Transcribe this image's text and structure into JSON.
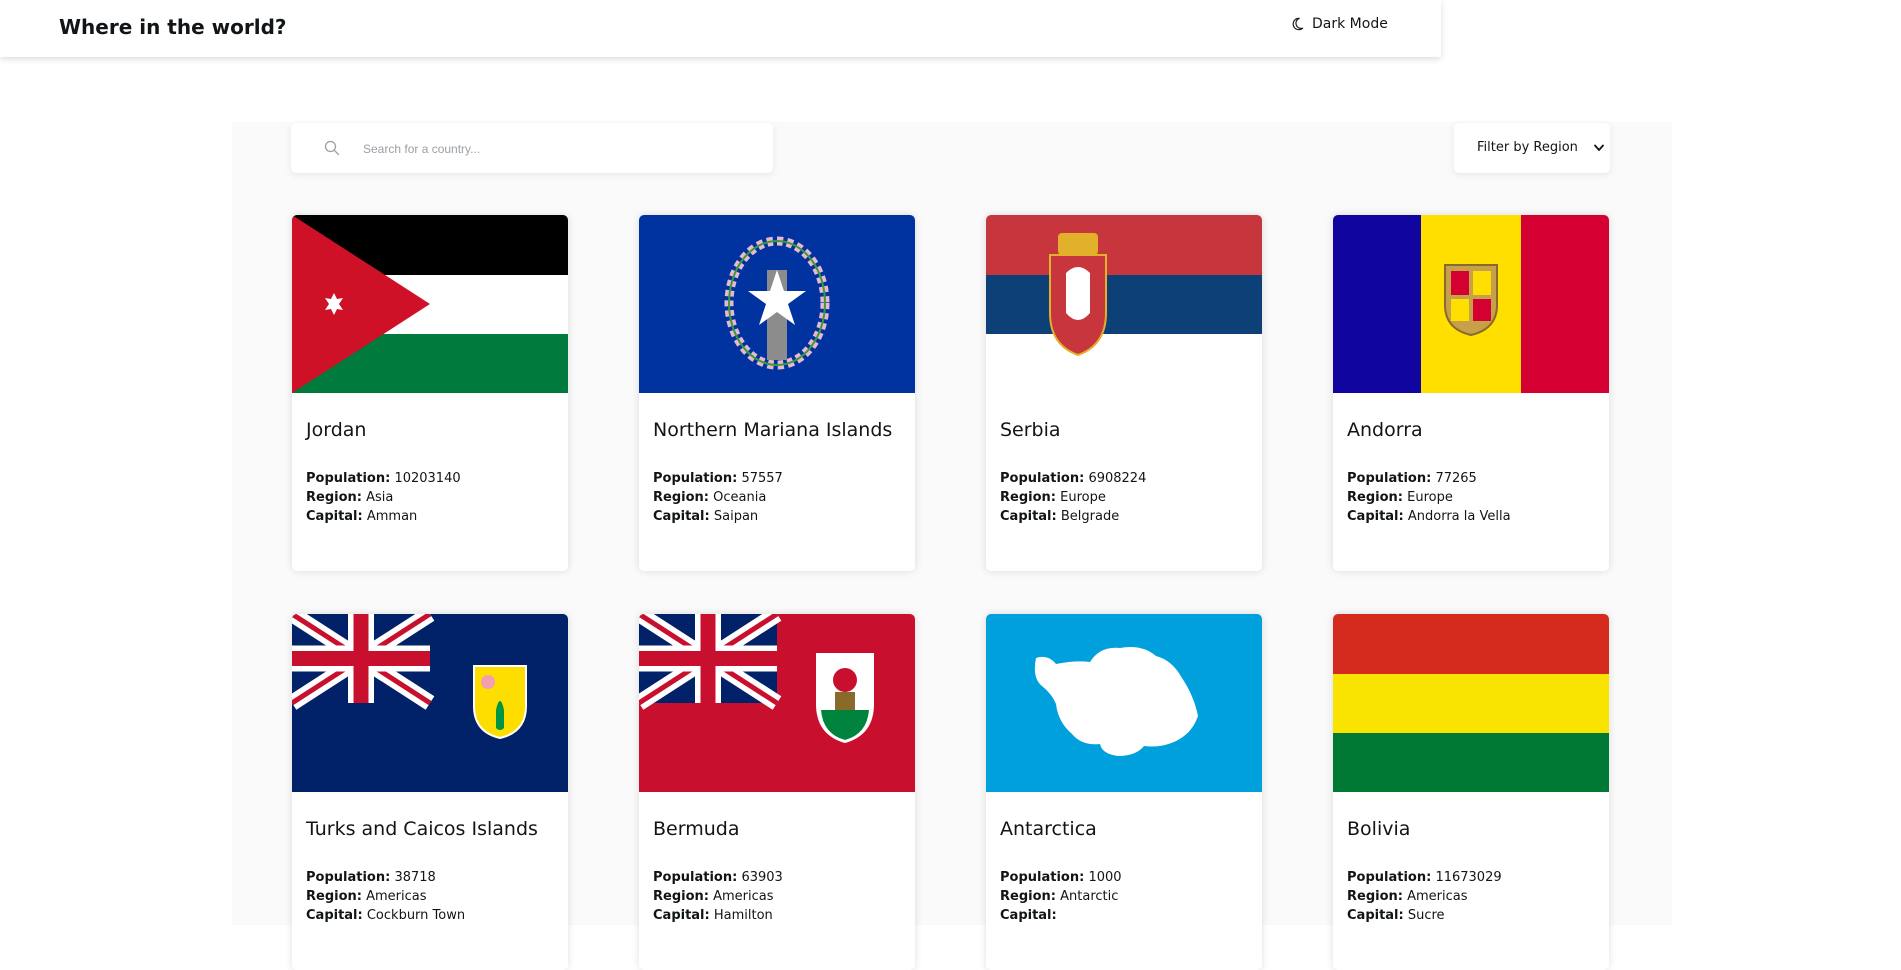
{
  "header": {
    "title": "Where in the world?",
    "theme_toggle_label": "Dark Mode",
    "theme_toggle_icon": "moon-icon"
  },
  "search": {
    "placeholder": "Search for a country...",
    "value": "",
    "icon": "search-icon"
  },
  "filter": {
    "selected_label": "Filter by Region",
    "icon": "chevron-down-icon"
  },
  "field_labels": {
    "population": "Population:",
    "region": "Region:",
    "capital": "Capital:"
  },
  "colors": {
    "page_background": "#fafafa",
    "card_background": "#ffffff",
    "text": "#111517"
  },
  "countries": [
    {
      "name": "Jordan",
      "population": "10203140",
      "region": "Asia",
      "capital": "Amman",
      "flag": "jordan-flag"
    },
    {
      "name": "Northern Mariana Islands",
      "population": "57557",
      "region": "Oceania",
      "capital": "Saipan",
      "flag": "northern-mariana-islands-flag"
    },
    {
      "name": "Serbia",
      "population": "6908224",
      "region": "Europe",
      "capital": "Belgrade",
      "flag": "serbia-flag"
    },
    {
      "name": "Andorra",
      "population": "77265",
      "region": "Europe",
      "capital": "Andorra la Vella",
      "flag": "andorra-flag"
    },
    {
      "name": "Turks and Caicos Islands",
      "population": "38718",
      "region": "Americas",
      "capital": "Cockburn Town",
      "flag": "turks-and-caicos-flag"
    },
    {
      "name": "Bermuda",
      "population": "63903",
      "region": "Americas",
      "capital": "Hamilton",
      "flag": "bermuda-flag"
    },
    {
      "name": "Antarctica",
      "population": "1000",
      "region": "Antarctic",
      "capital": "",
      "flag": "antarctica-flag"
    },
    {
      "name": "Bolivia",
      "population": "11673029",
      "region": "Americas",
      "capital": "Sucre",
      "flag": "bolivia-flag"
    }
  ]
}
